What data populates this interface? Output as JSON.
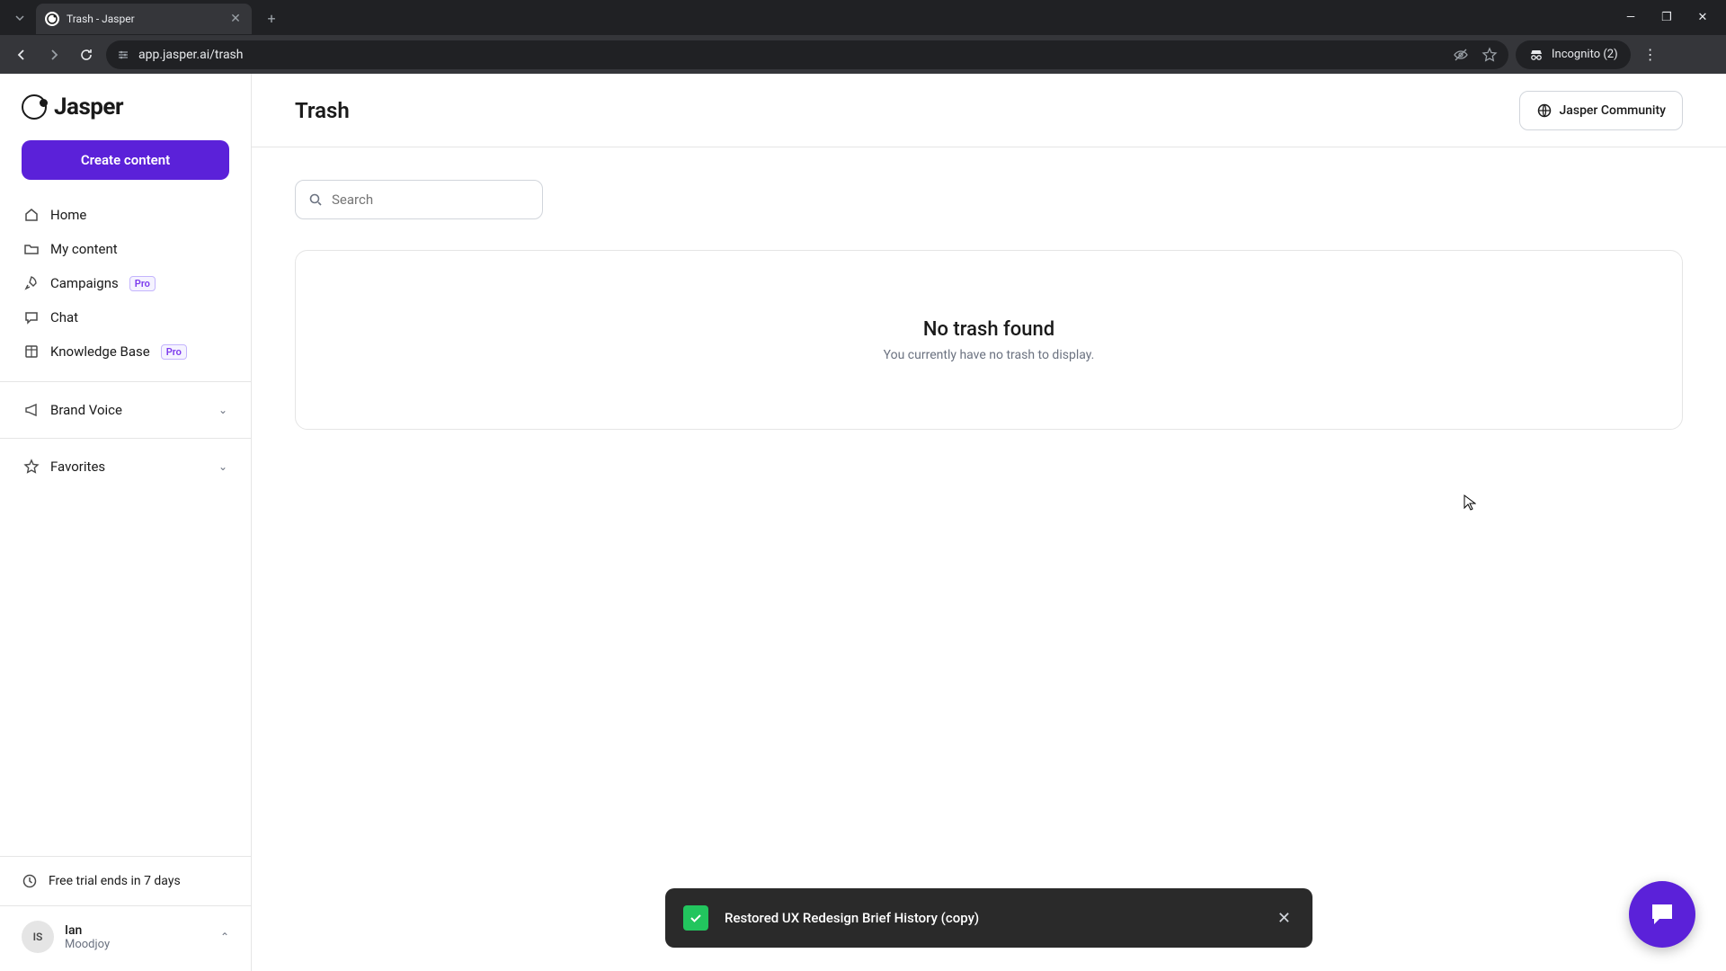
{
  "browser": {
    "tab_title": "Trash - Jasper",
    "url": "app.jasper.ai/trash",
    "incognito_label": "Incognito (2)"
  },
  "sidebar": {
    "logo_text": "Jasper",
    "create_label": "Create content",
    "nav": [
      {
        "label": "Home"
      },
      {
        "label": "My content"
      },
      {
        "label": "Campaigns",
        "badge": "Pro"
      },
      {
        "label": "Chat"
      },
      {
        "label": "Knowledge Base",
        "badge": "Pro"
      }
    ],
    "sections": [
      {
        "label": "Brand Voice"
      },
      {
        "label": "Favorites"
      }
    ],
    "trial_label": "Free trial ends in 7 days",
    "user": {
      "initials": "IS",
      "name": "Ian",
      "org": "Moodjoy"
    }
  },
  "header": {
    "title": "Trash",
    "community_label": "Jasper Community"
  },
  "search": {
    "placeholder": "Search"
  },
  "empty": {
    "title": "No trash found",
    "subtitle": "You currently have no trash to display."
  },
  "toast": {
    "message": "Restored UX Redesign Brief History (copy)"
  }
}
